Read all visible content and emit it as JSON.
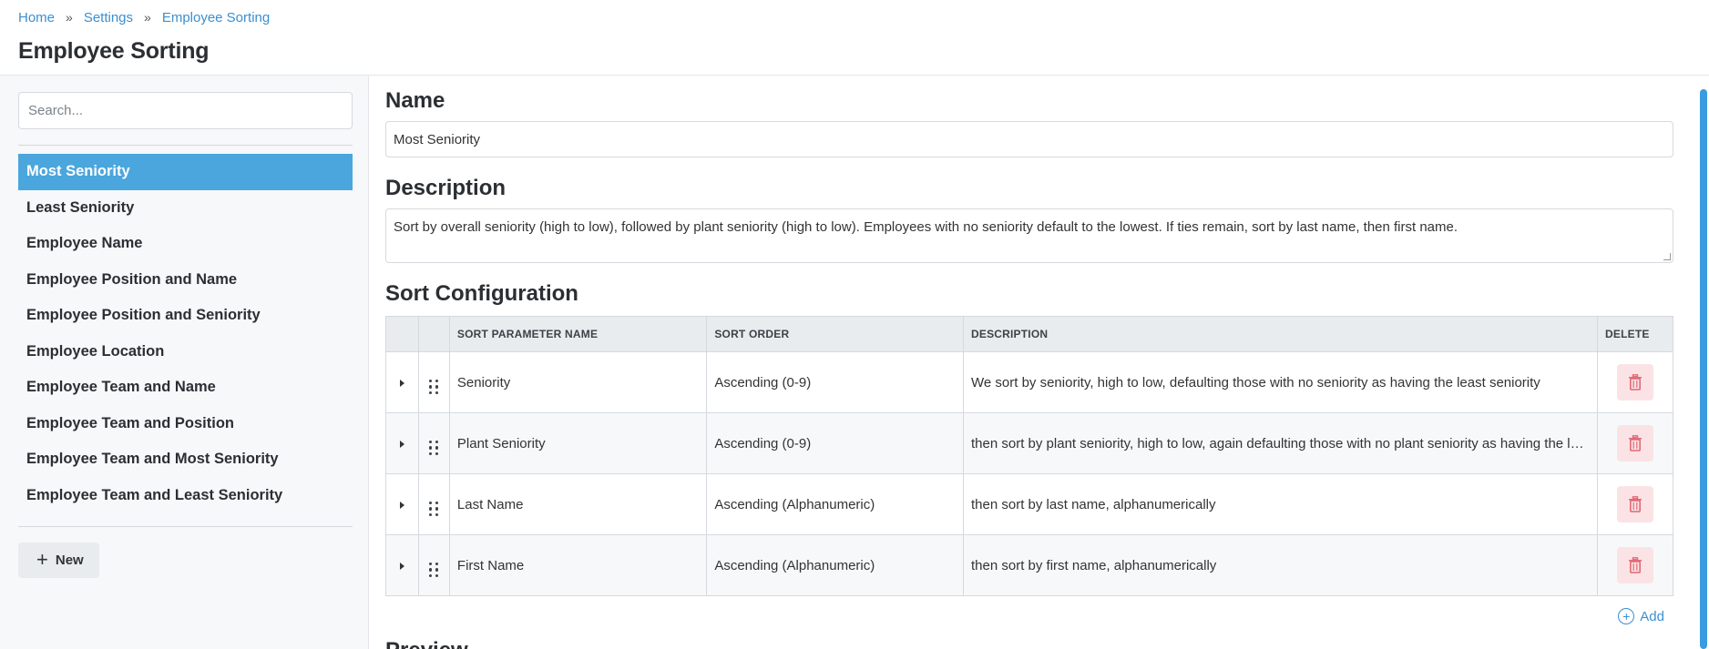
{
  "breadcrumb": {
    "home": "Home",
    "sep1": "»",
    "settings": "Settings",
    "sep2": "»",
    "current": "Employee Sorting"
  },
  "page_title": "Employee Sorting",
  "sidebar": {
    "search_placeholder": "Search...",
    "items": [
      {
        "label": "Most Seniority",
        "active": true
      },
      {
        "label": "Least Seniority"
      },
      {
        "label": "Employee Name"
      },
      {
        "label": "Employee Position and Name"
      },
      {
        "label": "Employee Position and Seniority"
      },
      {
        "label": "Employee Location"
      },
      {
        "label": "Employee Team and Name"
      },
      {
        "label": "Employee Team and Position"
      },
      {
        "label": "Employee Team and Most Seniority"
      },
      {
        "label": "Employee Team and Least Seniority"
      }
    ],
    "new_label": "New",
    "new_icon": "plus-icon"
  },
  "main": {
    "name_title": "Name",
    "name_value": "Most Seniority",
    "description_title": "Description",
    "description_value": "Sort by overall seniority (high to low), followed by plant seniority (high to low). Employees with no seniority default to the lowest. If ties remain, sort by last name, then first name.",
    "sort_title": "Sort Configuration",
    "columns": {
      "name": "SORT PARAMETER NAME",
      "order": "SORT ORDER",
      "description": "DESCRIPTION",
      "delete": "DELETE"
    },
    "rows": [
      {
        "name": "Seniority",
        "order": "Ascending (0-9)",
        "description": "We sort by seniority, high to low, defaulting those with no seniority as having the least seniority"
      },
      {
        "name": "Plant Seniority",
        "order": "Ascending (0-9)",
        "description": "then sort by plant seniority, high to low, again defaulting those with no plant seniority as having the least seniority"
      },
      {
        "name": "Last Name",
        "order": "Ascending (Alphanumeric)",
        "description": "then sort by last name, alphanumerically"
      },
      {
        "name": "First Name",
        "order": "Ascending (Alphanumeric)",
        "description": "then sort by first name, alphanumerically"
      }
    ],
    "add_label": "Add",
    "preview_title": "Preview"
  },
  "colors": {
    "accent": "#4aa6dd",
    "link": "#3a8fd0",
    "delete_bg": "#fbe3e5",
    "delete_icon": "#e06b78"
  }
}
